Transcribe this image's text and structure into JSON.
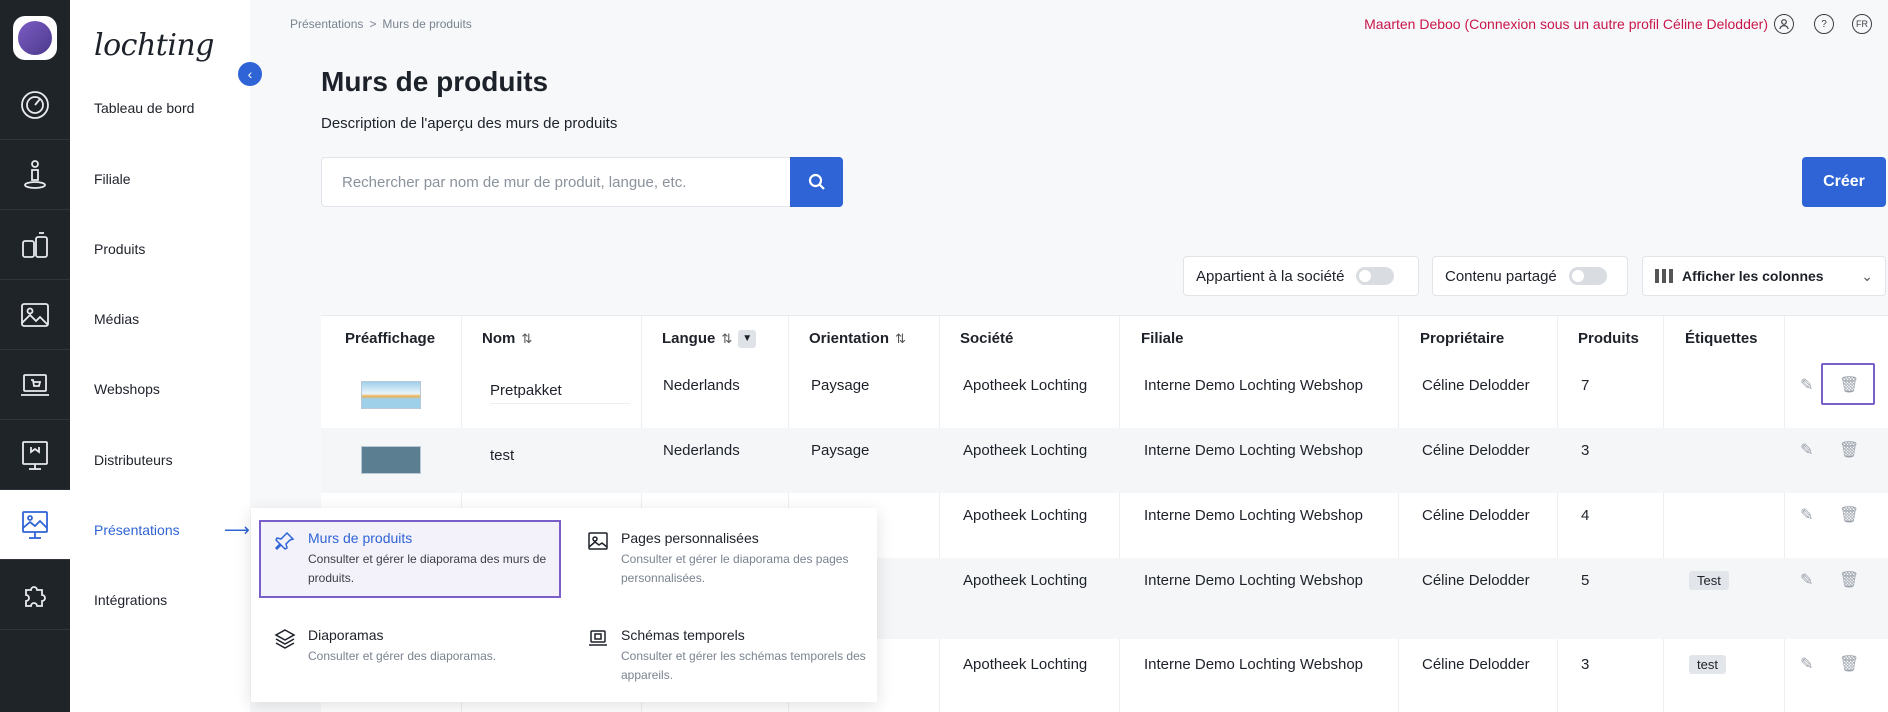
{
  "brand": "lochting",
  "nav": {
    "items": [
      {
        "label": "Tableau de bord"
      },
      {
        "label": "Filiale"
      },
      {
        "label": "Produits"
      },
      {
        "label": "Médias"
      },
      {
        "label": "Webshops"
      },
      {
        "label": "Distributeurs"
      },
      {
        "label": "Présentations"
      },
      {
        "label": "Intégrations"
      }
    ],
    "active_arrow": "⟶"
  },
  "breadcrumb": {
    "parent": "Présentations",
    "sep": ">",
    "current": "Murs de produits"
  },
  "header": {
    "profile": "Maarten Deboo (Connexion sous un autre profil Céline Delodder)",
    "help": "?",
    "lang": "FR"
  },
  "page": {
    "title": "Murs de produits",
    "description": "Description de l'aperçu des murs de produits"
  },
  "search": {
    "placeholder": "Rechercher par nom de mur de produit, langue, etc."
  },
  "create_label": "Créer",
  "filters": {
    "company": "Appartient à la société",
    "shared": "Contenu partagé",
    "columns": "Afficher les colonnes"
  },
  "table": {
    "headers": {
      "preview": "Préaffichage",
      "name": "Nom",
      "language": "Langue",
      "orientation": "Orientation",
      "company": "Société",
      "branch": "Filiale",
      "owner": "Propriétaire",
      "products": "Produits",
      "tags": "Étiquettes"
    },
    "rows": [
      {
        "name": "Pretpakket",
        "language": "Nederlands",
        "orientation": "Paysage",
        "company": "Apotheek Lochting",
        "branch": "Interne Demo Lochting Webshop",
        "owner": "Céline Delodder",
        "products": "7",
        "tag": ""
      },
      {
        "name": "test",
        "language": "Nederlands",
        "orientation": "Paysage",
        "company": "Apotheek Lochting",
        "branch": "Interne Demo Lochting Webshop",
        "owner": "Céline Delodder",
        "products": "3",
        "tag": ""
      },
      {
        "name": "",
        "language": "",
        "orientation": "",
        "company": "Apotheek Lochting",
        "branch": "Interne Demo Lochting Webshop",
        "owner": "Céline Delodder",
        "products": "4",
        "tag": ""
      },
      {
        "name": "",
        "language": "",
        "orientation": "",
        "company": "Apotheek Lochting",
        "branch": "Interne Demo Lochting Webshop",
        "owner": "Céline Delodder",
        "products": "5",
        "tag": "Test"
      },
      {
        "name": "",
        "language": "",
        "orientation": "",
        "company": "Apotheek Lochting",
        "branch": "Interne Demo Lochting Webshop",
        "owner": "Céline Delodder",
        "products": "3",
        "tag": "test"
      }
    ]
  },
  "dropdown": {
    "items": [
      {
        "title": "Murs de produits",
        "desc": "Consulter et gérer le diaporama des murs de produits."
      },
      {
        "title": "Pages personnalisées",
        "desc": "Consulter et gérer le diaporama des pages personnalisées."
      },
      {
        "title": "Diaporamas",
        "desc": "Consulter et gérer des diaporamas."
      },
      {
        "title": "Schémas temporels",
        "desc": "Consulter et gérer les schémas temporels des appareils."
      }
    ]
  },
  "colors": {
    "accent": "#2f64d6",
    "profile": "#c8174c",
    "focus": "#7b5fc8",
    "rail": "#1f2428"
  }
}
